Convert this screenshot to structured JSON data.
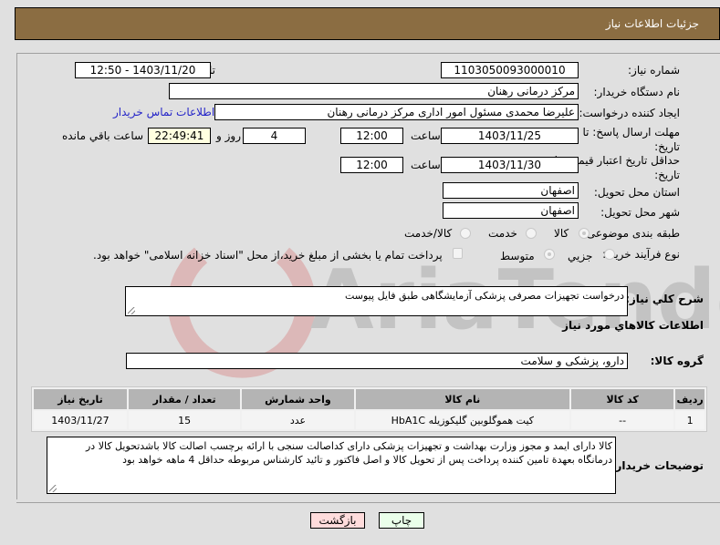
{
  "header": {
    "title": "جزئیات اطلاعات نیاز"
  },
  "fields": {
    "need_number_label": "شماره نیاز:",
    "need_number": "1103050093000010",
    "announce_label": "تاریخ و ساعت اعلان عمومی:",
    "announce_value": "1403/11/20 - 12:50",
    "buyer_org_label": "نام دستگاه خریدار:",
    "buyer_org": "مرکز درمانی رهنان",
    "creator_label": "ایجاد کننده درخواست:",
    "creator": "علیرضا محمدی مسئول امور اداری مرکز درمانی رهنان",
    "contact_link": "اطلاعات تماس خریدار",
    "reply_deadline_label": "مهلت ارسال پاسخ: تا تاریخ:",
    "reply_date": "1403/11/25",
    "time_label": "ساعت",
    "reply_time": "12:00",
    "days_left": "4",
    "days_and_label": "روز و",
    "time_left": "22:49:41",
    "time_left_label": "ساعت باقي مانده",
    "price_validity_label": "حداقل تاریخ اعتبار قیمت: تا تاریخ:",
    "price_date": "1403/11/30",
    "price_time": "12:00",
    "province_label": "استان محل تحویل:",
    "province": "اصفهان",
    "city_label": "شهر محل تحویل:",
    "city": "اصفهان",
    "category_label": "طبقه بندی موضوعی:",
    "category_options": [
      "کالا",
      "خدمت",
      "کالا/خدمت"
    ],
    "category_selected": "کالا",
    "purchase_type_label": "نوع فرآیند خرید :",
    "purchase_options": [
      "جزیي",
      "متوسط"
    ],
    "purchase_selected": "متوسط",
    "treasury_note": "پرداخت تمام یا بخشی از مبلغ خرید،از محل \"اسناد خزانه اسلامی\" خواهد بود.",
    "description_label": "شرح كلي نياز:",
    "description": "درخواست تجهیزات مصرفی پزشکی آزمایشگاهی طبق فایل پیوست",
    "goods_info_title": "اطلاعات كالاهاي مورد نياز",
    "goods_group_label": "گروه كالا:",
    "goods_group": "دارو، پزشکی و سلامت"
  },
  "table": {
    "headers": [
      "ردیف",
      "کد کالا",
      "نام کالا",
      "واحد شمارش",
      "تعداد / مقدار",
      "تاریخ نیاز"
    ],
    "rows": [
      [
        "1",
        "--",
        "کیت هموگلوبین گلیکوزیله HbA1C",
        "عدد",
        "15",
        "1403/11/27"
      ]
    ]
  },
  "buyer_notes": {
    "label": "توضیحات خریدار:",
    "text": "کالا دارای ایمد و مجوز وزارت بهداشت و تجهیزات پزشکی دارای کداصالت سنجی با ارائه برچسب اصالت  کالا باشدتحویل کالا در درمانگاه بعهدة تامین کننده پرداخت پس از تحویل کالا و اصل فاکتور و تائید کارشناس مربوطه حداقل 4 ماهه خواهد بود"
  },
  "buttons": {
    "print": "چاپ",
    "back": "بازگشت"
  },
  "colors": {
    "header_bg": "#8b6d42",
    "link": "#2525c8",
    "print_bg": "#eaffea",
    "back_bg": "#ffdcdc"
  }
}
